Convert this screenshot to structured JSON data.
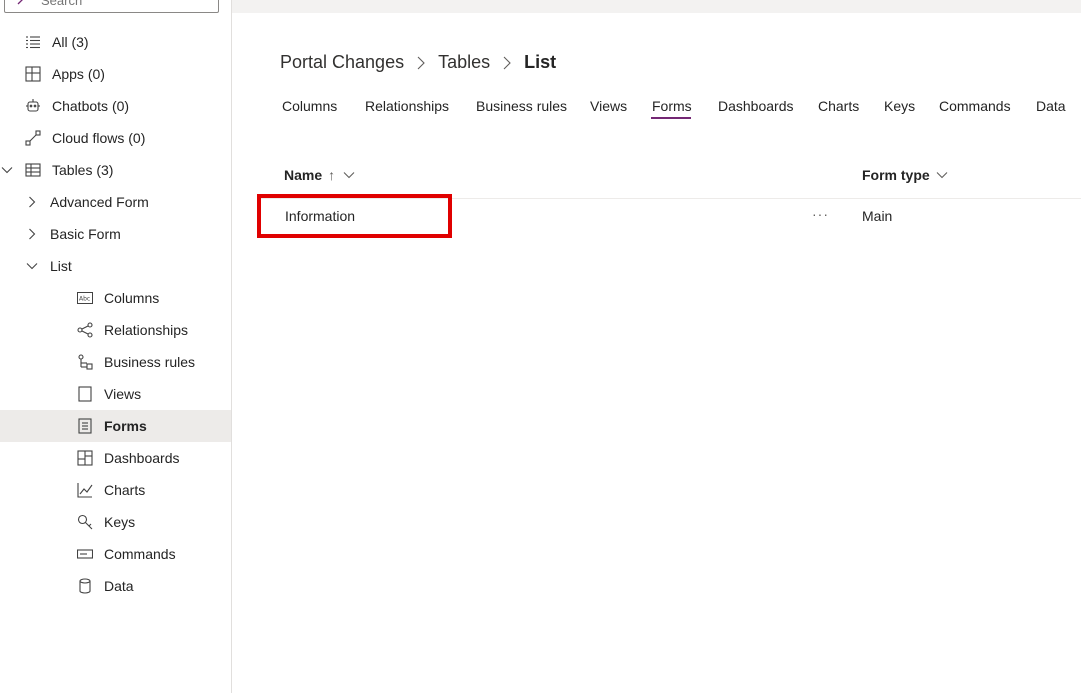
{
  "sidebar": {
    "search_placeholder": "Search",
    "items": [
      {
        "label": "All",
        "count": "(3)"
      },
      {
        "label": "Apps",
        "count": "(0)"
      },
      {
        "label": "Chatbots",
        "count": "(0)"
      },
      {
        "label": "Cloud flows",
        "count": "(0)"
      },
      {
        "label": "Tables",
        "count": "(3)"
      }
    ],
    "tables": [
      "Advanced Form",
      "Basic Form",
      "List"
    ],
    "list_children": [
      "Columns",
      "Relationships",
      "Business rules",
      "Views",
      "Forms",
      "Dashboards",
      "Charts",
      "Keys",
      "Commands",
      "Data"
    ]
  },
  "breadcrumb": [
    "Portal Changes",
    "Tables",
    "List"
  ],
  "tabs": [
    "Columns",
    "Relationships",
    "Business rules",
    "Views",
    "Forms",
    "Dashboards",
    "Charts",
    "Keys",
    "Commands",
    "Data"
  ],
  "active_tab": "Forms",
  "table": {
    "columns": [
      "Name",
      "Form type"
    ],
    "sort_indicator": "↑",
    "rows": [
      {
        "name": "Information",
        "form_type": "Main",
        "more": "···"
      }
    ]
  },
  "colors": {
    "accent": "#742774",
    "highlight": "#e00000",
    "selected_bg": "#edebe9"
  }
}
